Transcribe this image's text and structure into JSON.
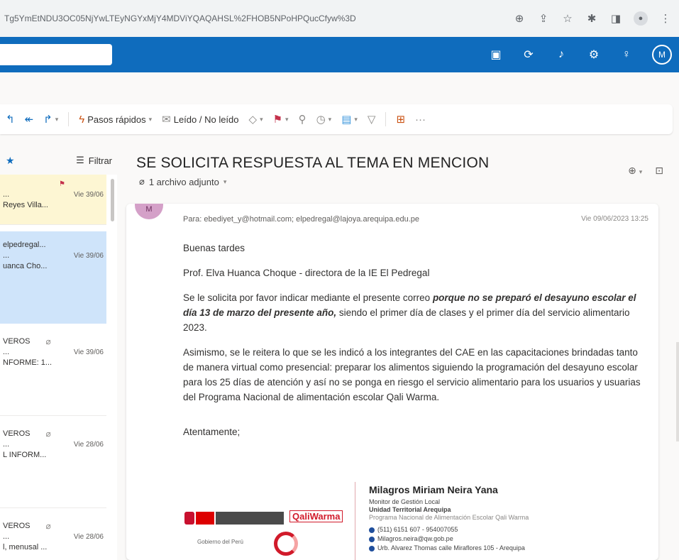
{
  "browser": {
    "url": "Tg5YmEtNDU3OC05NjYwLTEyNGYxMjY4MDViYQAQAHSL%2FHOB5NPoHPQucCfyw%3D"
  },
  "header": {
    "avatar_initial": "M"
  },
  "toolbar": {
    "quick_steps": "Pasos rápidos",
    "read_unread": "Leído / No leído"
  },
  "list": {
    "filter_label": "Filtrar",
    "items": [
      {
        "sender": "",
        "date": "Vie 39/06",
        "preview": "Reyes Villa..."
      },
      {
        "sender": "elpedregal...",
        "date": "Vie 39/06",
        "preview": "uanca Cho..."
      },
      {
        "sender": "VEROS",
        "date": "Vie 39/06",
        "preview": "NFORME: 1..."
      },
      {
        "sender": "VEROS",
        "date": "Vie 28/06",
        "preview": "L INFORM..."
      },
      {
        "sender": "VEROS",
        "date": "Vie 28/06",
        "preview": "l, menusal ..."
      }
    ]
  },
  "email": {
    "subject": "SE SOLICITA RESPUESTA AL TEMA EN MENCION",
    "attachments": "1 archivo adjunto",
    "sender_initial": "M",
    "to_line": "Para: ebediyet_y@hotmail.com; elpedregal@lajoya.arequipa.edu.pe",
    "date": "Vie 09/06/2023 13:25",
    "greeting": "Buenas tardes",
    "addressee": "Prof. Elva Huanca Choque - directora de la IE El Pedregal",
    "p1_start": "Se le solicita por favor indicar mediante el presente correo ",
    "p1_emph": "porque no se preparó el desayuno escolar el día 13 de marzo del presente año,",
    "p1_end": " siendo el primer día de clases y el primer día del servicio alimentario 2023.",
    "p2": "Asimismo, se le reitera lo que se les indicó a los integrantes del CAE en las capacitaciones brindadas tanto de manera virtual como presencial: preparar los alimentos siguiendo la programación del desayuno escolar para los 25 días de atención y así no se ponga en riesgo el servicio alimentario para los usuarios y usuarias del Programa Nacional de alimentación escolar Qali Warma.",
    "closing": "Atentamente;"
  },
  "signature": {
    "name": "Milagros Miriam Neira Yana",
    "line1": "Monitor de Gestión Local",
    "line2": "Unidad Territorial Arequipa",
    "line3": "Programa Nacional de Alimentación Escolar Qali Warma",
    "phone": "(511) 6151 607 - 954007055",
    "email": "Milagros.neira@qw.gob.pe",
    "address": "Urb. Alvarez Thomas calle Miraflores 105 - Arequipa",
    "qw_logo": "QaliWarma",
    "gob_label": "Gobierno del Perú"
  }
}
